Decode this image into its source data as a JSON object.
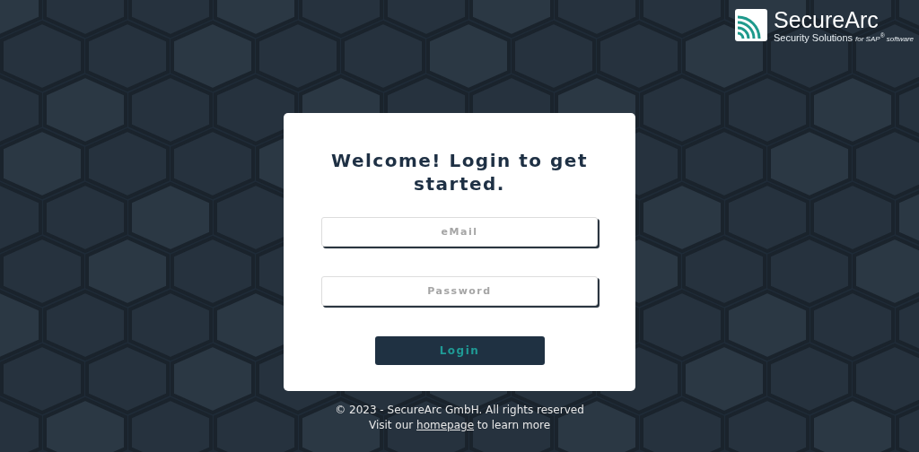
{
  "logo": {
    "name": "SecureArc",
    "tagline": "Security Solutions",
    "tagline_suffix": "for SAP$^{®}$ software"
  },
  "login": {
    "title": "Welcome! Login to get started.",
    "email": {
      "placeholder": "eMail"
    },
    "password": {
      "placeholder": "Password"
    },
    "button": "Login"
  },
  "footer": {
    "copyright": "© 2023 - SecureArc GmbH. All rights reserved",
    "visit_before": "Visit our ",
    "link": "homepage",
    "visit_after": " to learn more"
  }
}
